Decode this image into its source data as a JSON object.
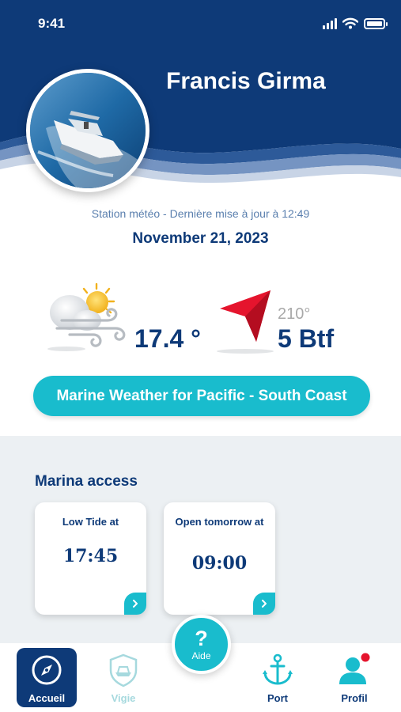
{
  "status_bar": {
    "time": "9:41"
  },
  "profile": {
    "name": "Francis Girma"
  },
  "weather": {
    "station_text": "Station météo - Dernière mise à jour à 12:49",
    "date": "November 21, 2023",
    "temperature": "17.4 °",
    "wind_direction": "210°",
    "wind_force": "5 Btf",
    "weather_icon": "sun-cloud-wind-icon",
    "wind_icon": "direction-arrow-icon"
  },
  "marine_button": {
    "label": "Marine Weather for Pacific - South Coast"
  },
  "marina": {
    "title": "Marina access",
    "cards": [
      {
        "label": "Low Tide at",
        "value": "17:45"
      },
      {
        "label": "Open tomorrow at",
        "value": "09:00"
      }
    ]
  },
  "help": {
    "symbol": "?",
    "label": "Aide"
  },
  "nav": {
    "items": [
      {
        "label": "Accueil",
        "icon": "compass-icon"
      },
      {
        "label": "Vigie",
        "icon": "shield-boat-icon"
      },
      {
        "label": "Port",
        "icon": "anchor-icon"
      },
      {
        "label": "Profil",
        "icon": "user-icon"
      }
    ]
  },
  "colors": {
    "navy": "#0e3a78",
    "teal": "#19bccd",
    "wind_arrow": "#e5142d",
    "notification": "#e5142d",
    "section_bg": "#ecf0f3"
  }
}
